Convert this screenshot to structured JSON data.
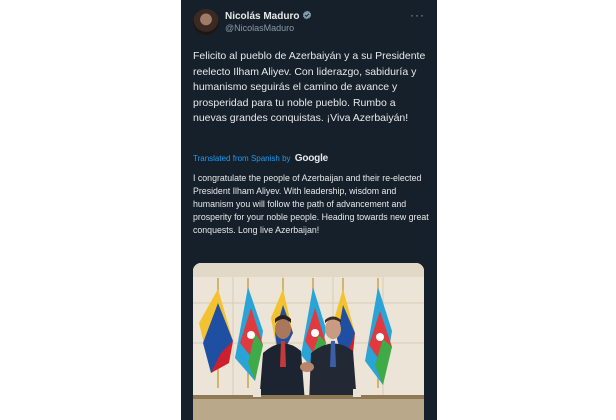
{
  "author": {
    "name": "Nicolás Maduro",
    "handle": "@NicolasMaduro"
  },
  "tweet": {
    "original_text": "Felicito al pueblo de Azerbaiyán y a su Presidente reelecto Ilham Aliyev. Con liderazgo, sabiduría y humanismo seguirás el camino de avance y prosperidad para tu noble pueblo. Rumbo a nuevas grandes conquistas. ¡Viva Azerbaiyán!",
    "translated_label": "Translated from Spanish by",
    "translator": "Google",
    "translated_text": "I congratulate the people of Azerbaijan and their re-elected President Ilham Aliyev. With leadership, wisdom and humanism you will follow the path of advancement and prosperity for your noble people. Heading towards new great conquests. Long live Azerbaijan!"
  },
  "colors": {
    "background": "#15202b",
    "text": "#e7e9ea",
    "secondary_text": "#8b98a5",
    "accent": "#1d9bf0"
  },
  "icons": [
    "verified-badge-icon",
    "more-options-icon"
  ]
}
